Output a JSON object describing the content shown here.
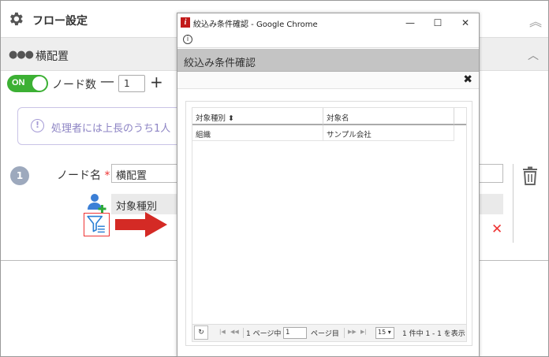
{
  "page": {
    "title": "フロー設定",
    "section_label": "横配置",
    "section_dots": "●●●",
    "toggle_label": "ON",
    "node_count_label": "ノード数",
    "minus": "—",
    "count_value": "1",
    "plus": "+",
    "info_text": "処理者には上長のうち1人",
    "node_number": "1",
    "node_name_label": "ノード名",
    "required_mark": "*",
    "node_name_value": "横配置",
    "target_type_header": "対象種別",
    "delete_mark": "✕"
  },
  "popup": {
    "window_title": "絞込み条件確認 - Google Chrome",
    "app_icon_letter": "i",
    "minimize": "—",
    "maximize": "☐",
    "close": "✕",
    "info_icon": "i",
    "dialog_title": "絞込み条件確認",
    "dialog_close": "✖",
    "columns": [
      "対象種別 ⬍",
      "対象名"
    ],
    "rows": [
      [
        "組織",
        "サンプル会社"
      ]
    ],
    "pager": {
      "refresh": "↻",
      "first": "|◀",
      "prev": "◀◀",
      "page_prefix": "1 ページ中",
      "page_value": "1",
      "page_suffix": "ページ目",
      "next": "▶▶",
      "last": "▶|",
      "page_size": "15",
      "summary": "1 件中 1 - 1 を表示"
    }
  }
}
